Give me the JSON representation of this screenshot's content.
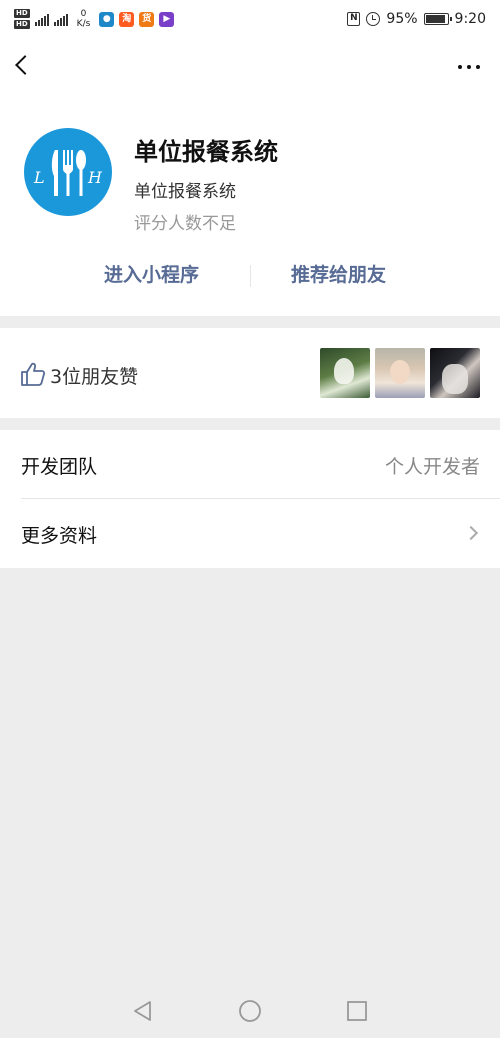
{
  "status_bar": {
    "network_speed_value": "0",
    "network_speed_unit": "K/s",
    "battery": "95%",
    "time": "9:20",
    "icons": [
      "hd-icon",
      "signal-icon",
      "signal-icon",
      "app-icon",
      "app-icon",
      "app-icon",
      "app-icon",
      "nfc-icon",
      "alarm-icon",
      "battery-icon"
    ]
  },
  "navbar": {
    "back_icon": "back-icon",
    "more_icon": "more-icon"
  },
  "app": {
    "name": "单位报餐系统",
    "subtitle": "单位报餐系统",
    "rating": "评分人数不足",
    "logo_letters": [
      "L",
      "H"
    ],
    "logo_color": "#1a98da"
  },
  "actions": {
    "enter_label": "进入小程序",
    "share_label": "推荐给朋友",
    "link_color": "#576b95"
  },
  "likes": {
    "text": "3位朋友赞",
    "icon": "thumbs-up-icon",
    "avatar_count": 3
  },
  "info": {
    "team_label": "开发团队",
    "team_value": "个人开发者",
    "more_label": "更多资料"
  }
}
